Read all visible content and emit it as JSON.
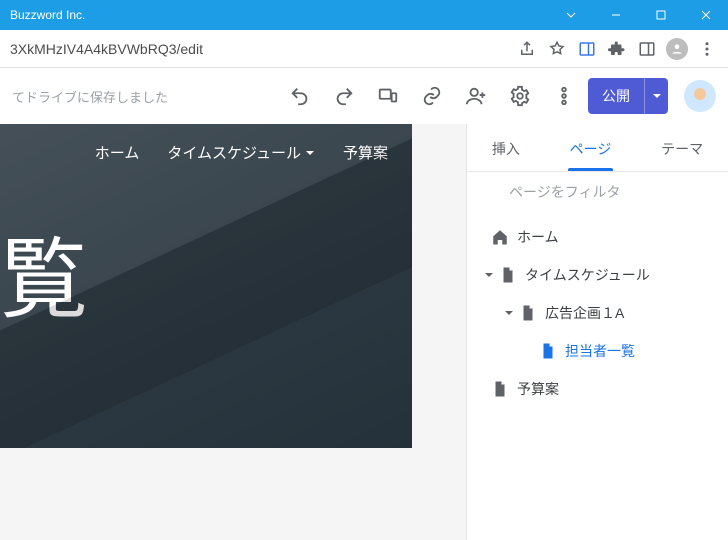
{
  "window": {
    "title": "Buzzword Inc."
  },
  "addressbar": {
    "url": "3XkMHzIV4A4kBVWbRQ3/edit"
  },
  "toolbar": {
    "saved_msg": "てドライブに保存しました",
    "publish_label": "公開"
  },
  "preview": {
    "nav": {
      "home": "ホーム",
      "schedule": "タイムスケジュール",
      "budget": "予算案"
    },
    "title_visible": "覧"
  },
  "sidepanel": {
    "tabs": {
      "insert": "挿入",
      "pages": "ページ",
      "theme": "テーマ"
    },
    "filter_placeholder": "ページをフィルタ",
    "tree": {
      "home": "ホーム",
      "schedule": "タイムスケジュール",
      "ad_plan": "広告企画１A",
      "assignees": "担当者一覧",
      "budget": "予算案"
    }
  }
}
